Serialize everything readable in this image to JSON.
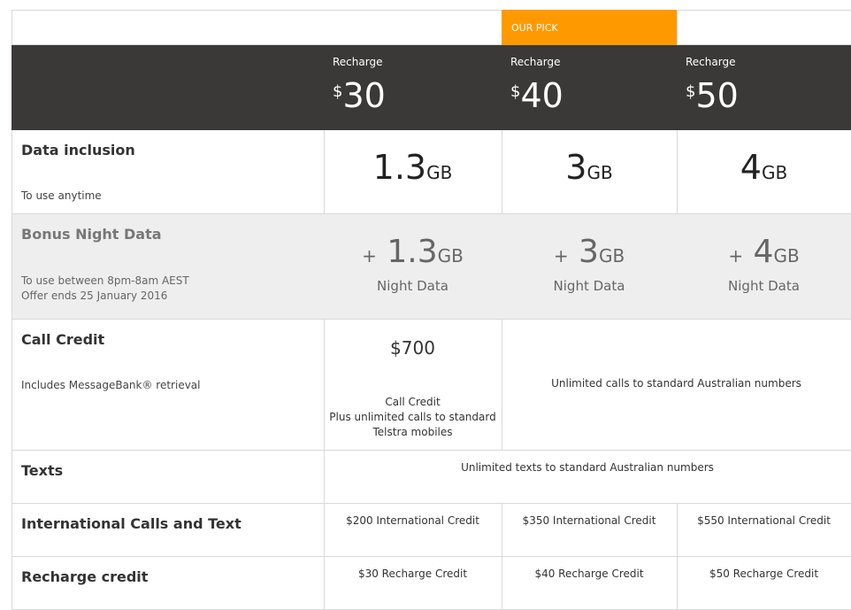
{
  "badge": {
    "label": "OUR PICK"
  },
  "plans": [
    {
      "recharge_label": "Recharge",
      "currency": "$",
      "price": "30"
    },
    {
      "recharge_label": "Recharge",
      "currency": "$",
      "price": "40"
    },
    {
      "recharge_label": "Recharge",
      "currency": "$",
      "price": "50"
    }
  ],
  "rows": {
    "data": {
      "title": "Data inclusion",
      "sub": "To use anytime",
      "values": [
        {
          "num": "1.3",
          "unit": "GB"
        },
        {
          "num": "3",
          "unit": "GB"
        },
        {
          "num": "4",
          "unit": "GB"
        }
      ]
    },
    "night": {
      "title": "Bonus Night Data",
      "sub_line1": "To use between 8pm-8am AEST",
      "sub_line2": "Offer ends 25 January 2016",
      "plus": "+",
      "label": "Night Data",
      "values": [
        {
          "num": "1.3",
          "unit": "GB"
        },
        {
          "num": "3",
          "unit": "GB"
        },
        {
          "num": "4",
          "unit": "GB"
        }
      ]
    },
    "call": {
      "title": "Call Credit",
      "sub": "Includes MessageBank® retrieval",
      "plan1_amount": "$700",
      "plan1_line1": "Call Credit",
      "plan1_line2": "Plus unlimited calls to standard",
      "plan1_line3": "Telstra mobiles",
      "plan23": "Unlimited calls to standard Australian numbers"
    },
    "texts": {
      "title": "Texts",
      "all": "Unlimited texts to standard Australian numbers"
    },
    "intl": {
      "title": "International Calls and Text",
      "values": [
        "$200 International Credit",
        "$350 International Credit",
        "$550 International Credit"
      ]
    },
    "recharge": {
      "title": "Recharge credit",
      "values": [
        "$30 Recharge Credit",
        "$40 Recharge Credit",
        "$50 Recharge Credit"
      ]
    }
  }
}
